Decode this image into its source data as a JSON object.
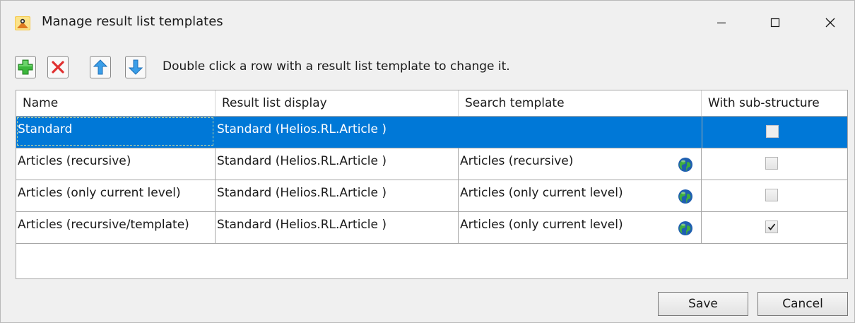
{
  "window": {
    "title": "Manage result list templates"
  },
  "toolbar": {
    "add_icon": "add-icon",
    "delete_icon": "delete-icon",
    "move_up_icon": "arrow-up-icon",
    "move_down_icon": "arrow-down-icon",
    "hint": "Double click a row with a result list template to change it."
  },
  "grid": {
    "columns": [
      "Name",
      "Result list display",
      "Search template",
      "With sub-structure"
    ],
    "rows": [
      {
        "name": "Standard",
        "display": "Standard (Helios.RL.Article )",
        "search": "",
        "globe": false,
        "sub_structure": false,
        "selected": true
      },
      {
        "name": "Articles (recursive)",
        "display": "Standard (Helios.RL.Article )",
        "search": "Articles (recursive)",
        "globe": true,
        "sub_structure": false,
        "selected": false
      },
      {
        "name": "Articles (only current level)",
        "display": "Standard (Helios.RL.Article )",
        "search": "Articles (only current level)",
        "globe": true,
        "sub_structure": false,
        "selected": false
      },
      {
        "name": "Articles (recursive/template)",
        "display": "Standard (Helios.RL.Article )",
        "search": "Articles (only current level)",
        "globe": true,
        "sub_structure": true,
        "selected": false
      }
    ]
  },
  "buttons": {
    "save": "Save",
    "cancel": "Cancel"
  },
  "colors": {
    "selection": "#0078d7",
    "window_bg": "#f0f0f0"
  }
}
